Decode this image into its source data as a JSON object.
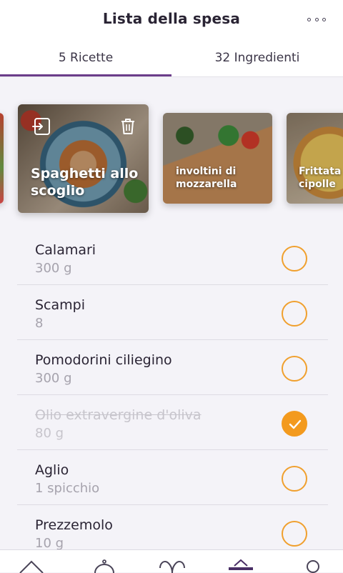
{
  "header": {
    "title": "Lista della spesa"
  },
  "tabs": [
    {
      "label": "5 Ricette"
    },
    {
      "label": "32 Ingredienti"
    }
  ],
  "recipes": [
    {
      "name": "Spaghetti allo scoglio"
    },
    {
      "name": "involtini di mozzarella"
    },
    {
      "name": "Frittata cipolle"
    }
  ],
  "ingredients": [
    {
      "name": "Calamari",
      "qty": "300 g",
      "checked": false
    },
    {
      "name": "Scampi",
      "qty": "8",
      "checked": false
    },
    {
      "name": "Pomodorini ciliegino",
      "qty": "300 g",
      "checked": false
    },
    {
      "name": "Olio extravergine d'oliva",
      "qty": "80 g",
      "checked": true
    },
    {
      "name": "Aglio",
      "qty": "1 spicchio",
      "checked": false
    },
    {
      "name": "Prezzemolo",
      "qty": "10 g",
      "checked": false
    }
  ],
  "nav": [
    "home-icon",
    "chef-hat-icon",
    "heart-icon",
    "basket-icon",
    "profile-icon"
  ],
  "colors": {
    "accent": "#6b3d8a",
    "check": "#f39a1e"
  }
}
